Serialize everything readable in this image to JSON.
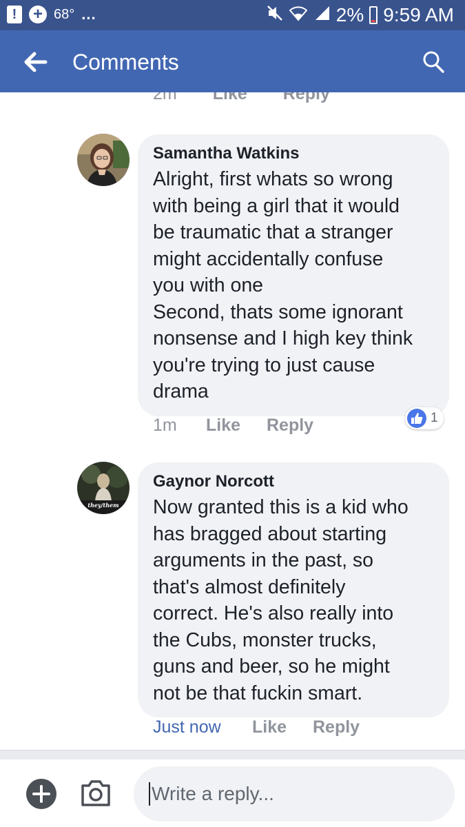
{
  "status_bar": {
    "temperature": "68°",
    "overflow": "...",
    "battery": "2%",
    "time": "9:59 AM"
  },
  "header": {
    "title": "Comments"
  },
  "previous_comment": {
    "timestamp": "2m",
    "like_label": "Like",
    "reply_label": "Reply"
  },
  "comments": [
    {
      "author": "Samantha Watkins",
      "text": "Alright, first whats so wrong\nwith being a girl that it would\nbe traumatic that a stranger\nmight accidentally confuse\nyou with one\nSecond, thats some ignorant\nnonsense and I high key think\nyou're trying to just cause\ndrama",
      "timestamp": "1m",
      "like_label": "Like",
      "reply_label": "Reply",
      "reaction_count": "1"
    },
    {
      "author": "Gaynor Norcott",
      "avatar_caption": "they/them",
      "text": "Now granted this is a kid who\nhas bragged about starting\narguments in the past, so\nthat's almost definitely\ncorrect. He's also really into\nthe Cubs, monster trucks,\nguns and beer, so he might\nnot be that fuckin smart.",
      "timestamp": "Just now",
      "like_label": "Like",
      "reply_label": "Reply"
    }
  ],
  "composer": {
    "placeholder": "Write a reply..."
  },
  "icons": {
    "back": "arrow-left-icon",
    "search": "search-icon",
    "add": "plus-circle-icon",
    "camera": "camera-icon",
    "like_reaction": "thumbs-up-icon"
  },
  "colors": {
    "status_bar": "#39538d",
    "header": "#4267b2",
    "bubble": "#f1f2f5",
    "link_blue": "#4267b2",
    "muted": "#90949c",
    "like_blue": "#4a76e8"
  }
}
